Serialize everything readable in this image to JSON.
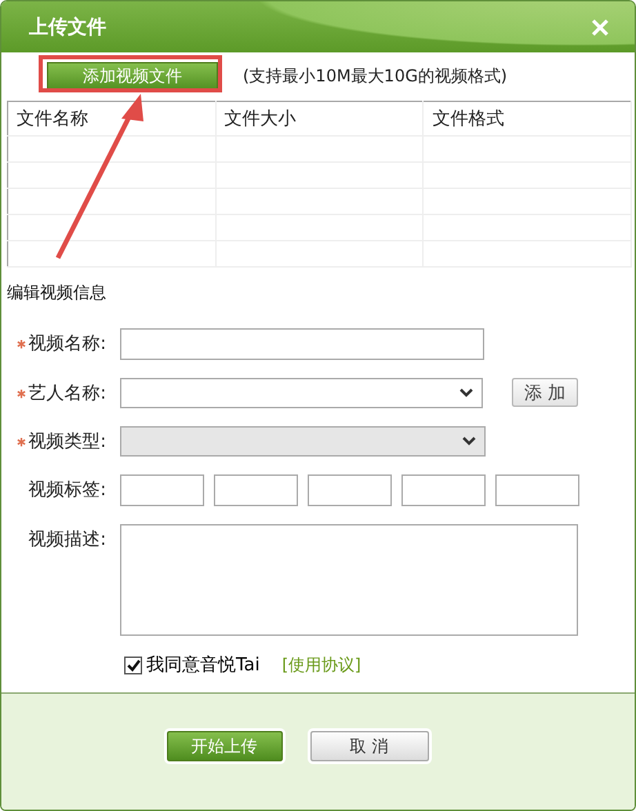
{
  "window": {
    "title": "上传文件"
  },
  "add_file_button": "添加视频文件",
  "format_hint": "(支持最小10M最大10G的视频格式)",
  "table": {
    "columns": [
      "文件名称",
      "文件大小",
      "文件格式"
    ]
  },
  "section_title": "编辑视频信息",
  "fields": [
    {
      "kind": "text",
      "label": "视频名称:",
      "required": true
    },
    {
      "kind": "select",
      "label": "艺人名称:",
      "required": true,
      "disabled": false,
      "button": "添 加"
    },
    {
      "kind": "select",
      "label": "视频类型:",
      "required": true,
      "disabled": true
    },
    {
      "kind": "tags",
      "label": "视频标签:",
      "required": false
    },
    {
      "kind": "textarea",
      "label": "视频描述:",
      "required": false
    }
  ],
  "agreement": {
    "checked": true,
    "label": "我同意音悦Tai",
    "link": "[使用协议]"
  },
  "buttons": {
    "submit": "开始上传",
    "cancel": "取 消"
  }
}
